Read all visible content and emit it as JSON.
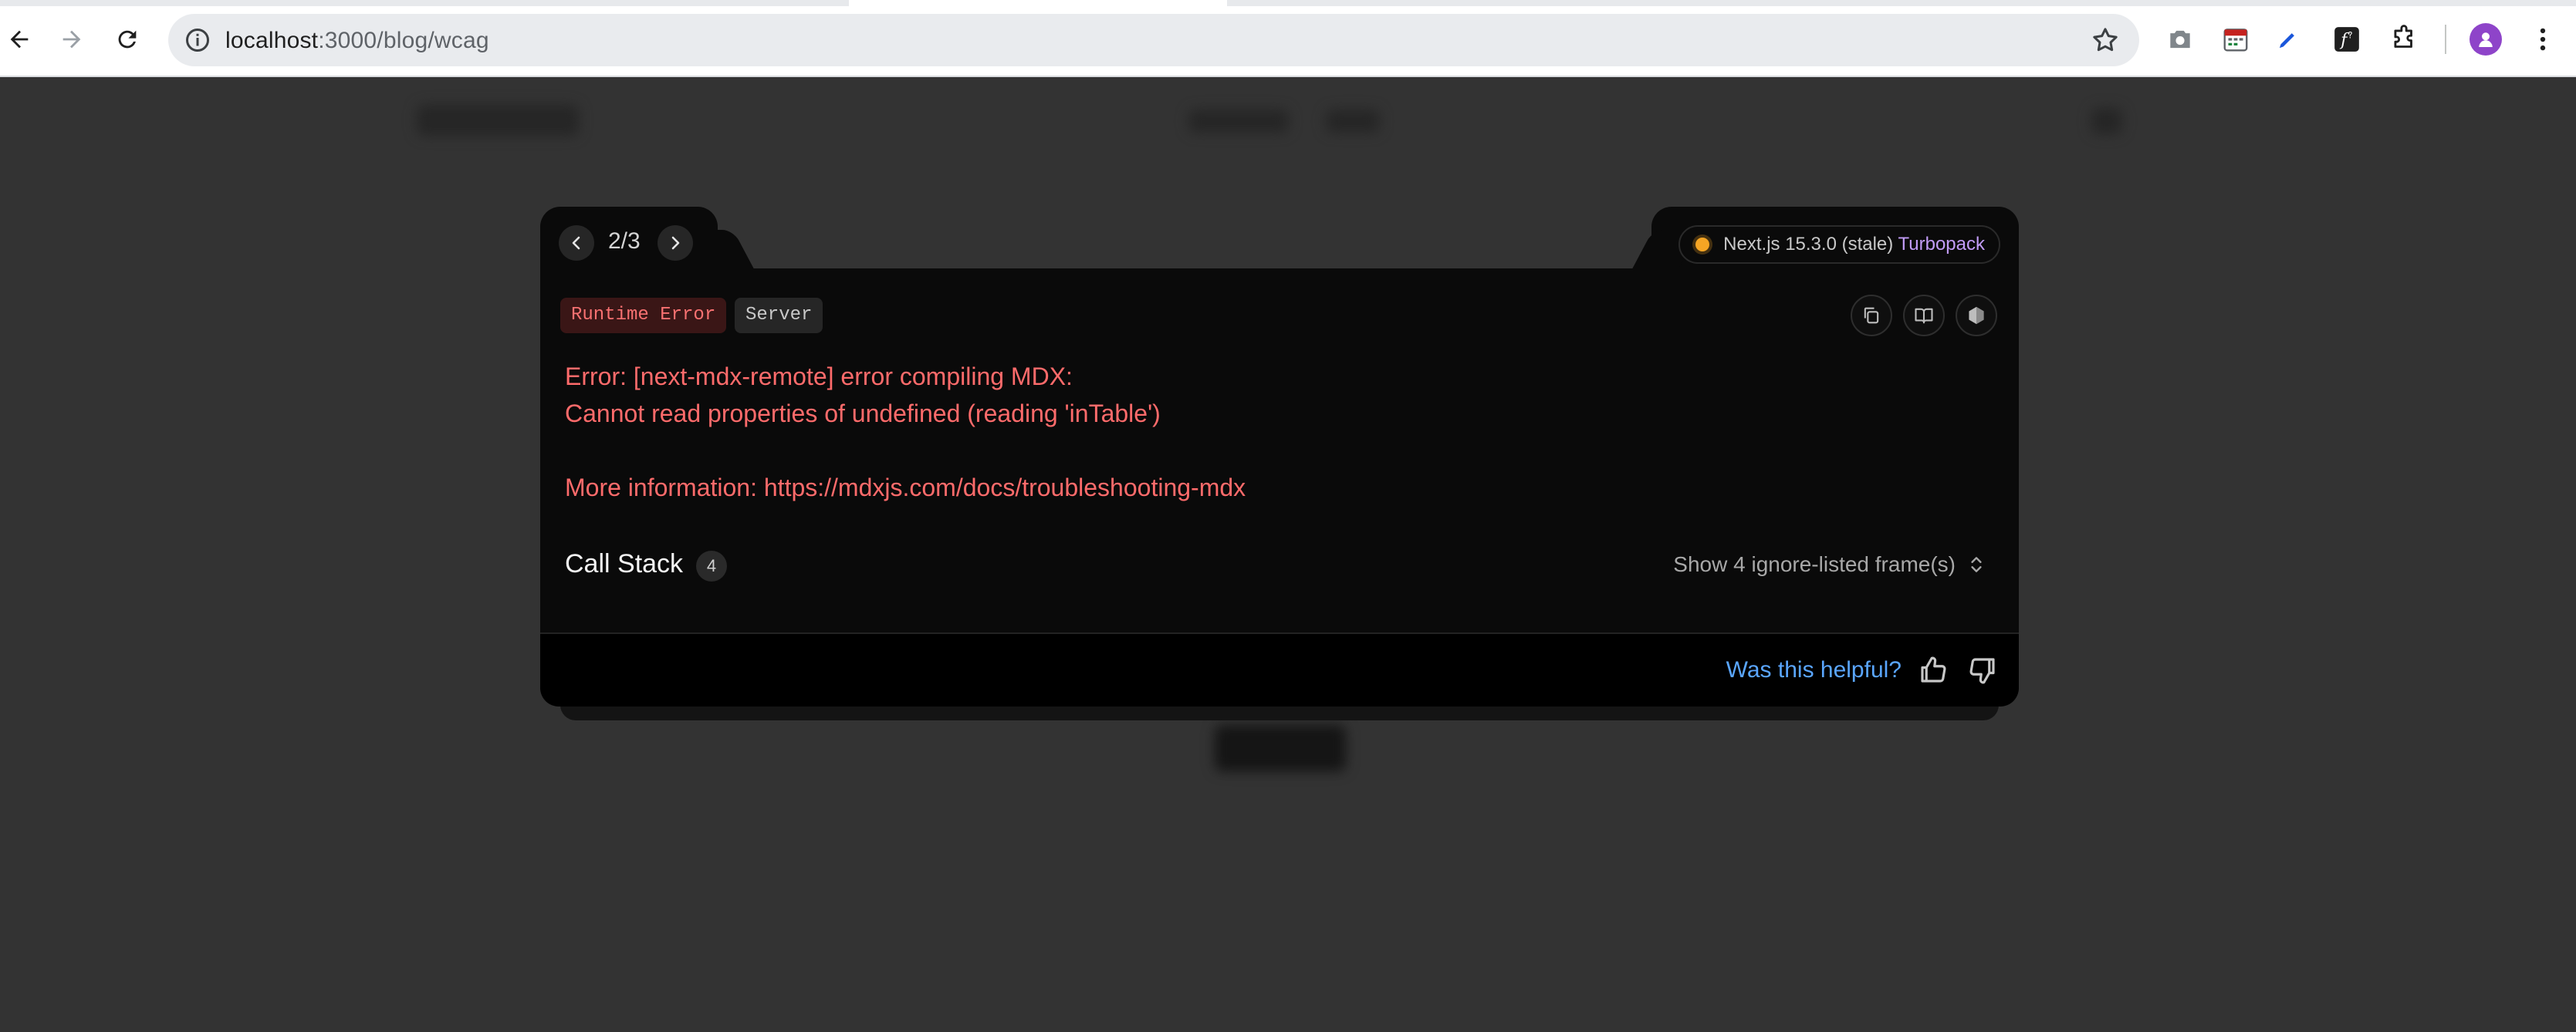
{
  "browser": {
    "url_host": "localhost",
    "url_path": ":3000/blog/wcag"
  },
  "overlay": {
    "pager": {
      "position": "2/3"
    },
    "version": {
      "label": "Next.js 15.3.0 (stale)",
      "bundler": "Turbopack",
      "status_color": "#f5a524"
    },
    "badges": {
      "error_type": "Runtime Error",
      "source": "Server"
    },
    "error": {
      "line1": "Error: [next-mdx-remote] error compiling MDX:",
      "line2": "Cannot read properties of undefined (reading 'inTable')",
      "line3": "More information: https://mdxjs.com/docs/troubleshooting-mdx"
    },
    "call_stack": {
      "title": "Call Stack",
      "count": "4",
      "ignored_toggle": "Show 4 ignore-listed frame(s)"
    },
    "feedback": {
      "question": "Was this helpful?"
    },
    "colors": {
      "error_text": "#ff6b6b",
      "link_blue": "#5aa6ff",
      "turbopack": "#c29cf7"
    }
  }
}
